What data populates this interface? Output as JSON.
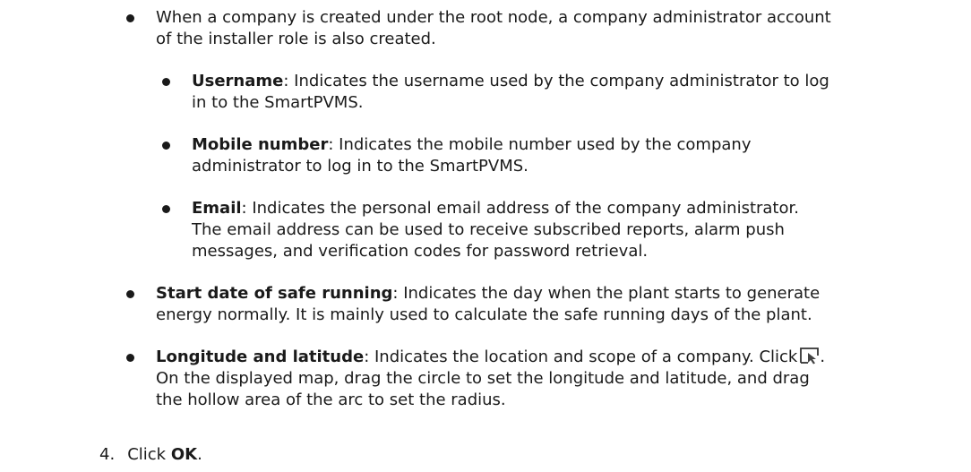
{
  "bullets": [
    {
      "line1": "When a company is created under the root node, a company administrator account",
      "line2": "of the installer role is also created."
    },
    {
      "term": "Username",
      "line1_rest": ": Indicates the username used by the company administrator to log",
      "line2": "in to the SmartPVMS."
    },
    {
      "term": "Mobile number",
      "line1_rest": ": Indicates the mobile number used by the company",
      "line2": "administrator to log in to the SmartPVMS."
    },
    {
      "term": "Email",
      "line1_rest": ": Indicates the personal email address of the company administrator.",
      "line2": "The email address can be used to receive subscribed reports, alarm push",
      "line3": "messages, and verification codes for password retrieval."
    },
    {
      "term": "Start date of safe running",
      "line1_rest": ": Indicates the day when the plant starts to generate",
      "line2": "energy normally. It is mainly used to calculate the safe running days of the plant."
    },
    {
      "term": "Longitude and latitude",
      "line1_rest": ": Indicates the location and scope of a company. Click",
      "line1_end": ".",
      "line2": "On the displayed map, drag the circle to set the longitude and latitude, and drag",
      "line3": "the hollow area of the arc to set the radius."
    }
  ],
  "icons": {
    "location_select": "select-location-icon"
  },
  "step": {
    "number": "4.",
    "text_before": "Click ",
    "button": "OK",
    "text_after": "."
  }
}
